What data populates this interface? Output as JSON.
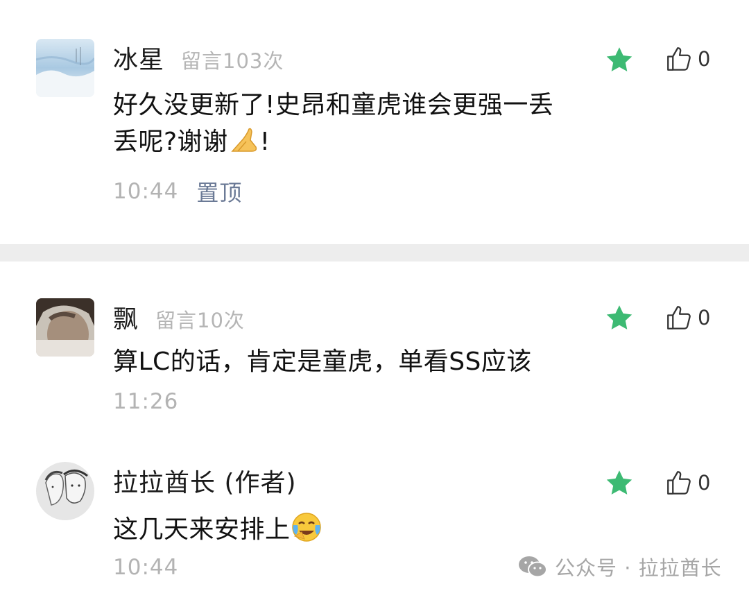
{
  "comments": [
    {
      "nickname": "冰星",
      "message_count": "留言103次",
      "content_line1": "好久没更新了!史昂和童虎谁会更强一丢",
      "content_line2": "丢呢?谢谢",
      "content_suffix": "!",
      "emoji": "folded-hands-emoji",
      "time": "10:44",
      "pinned_label": "置顶",
      "likes": "0",
      "featured": true
    },
    {
      "nickname": "飘",
      "message_count": "留言10次",
      "content_line1": "算LC的话，肯定是童虎，单看SS应该",
      "time": "11:26",
      "likes": "0",
      "featured": true
    },
    {
      "nickname": "拉拉酋长 (作者)",
      "content_line1": "这几天来安排上",
      "emoji": "crying-laughing-emoji",
      "time": "10:44",
      "likes": "0",
      "featured": true
    }
  ],
  "watermark": "公众号 · 拉拉酋长",
  "colors": {
    "star": "#3dba73",
    "meta_text": "#b3b3b3",
    "pin_text": "#6b7a96",
    "divider": "#ededed"
  }
}
